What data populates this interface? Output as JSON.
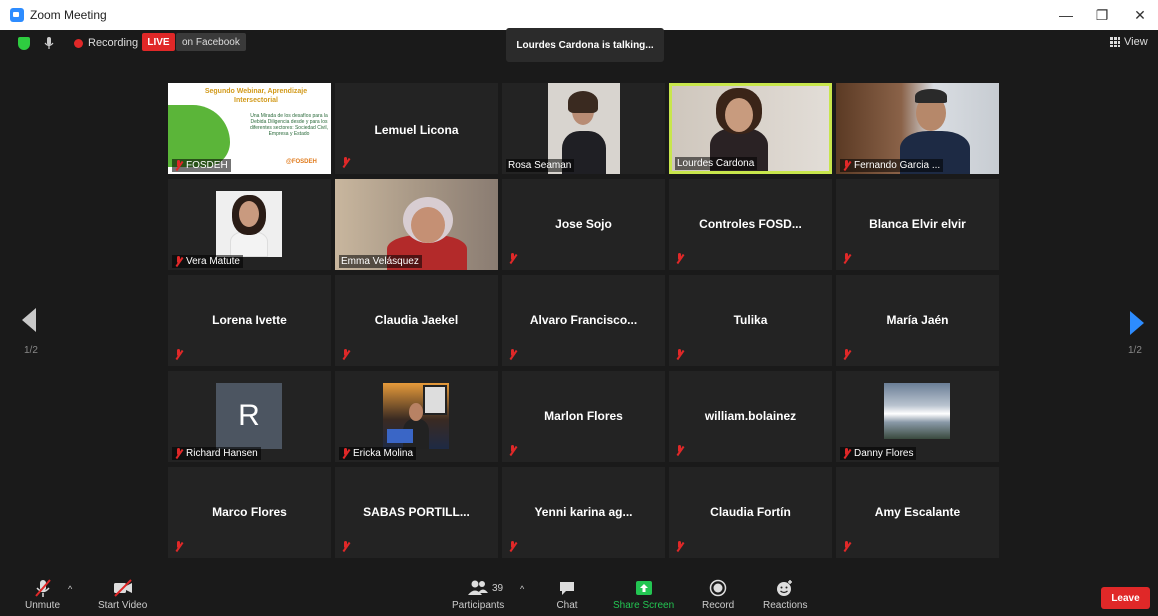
{
  "window": {
    "title": "Zoom Meeting",
    "minimize": "—",
    "restore": "❐",
    "close": "✕"
  },
  "topbar": {
    "recording_label": "Recording",
    "live_label": "LIVE",
    "on_facebook_label": "on Facebook",
    "talking_text": "Lourdes Cardona is talking...",
    "view_label": "View"
  },
  "pagination": {
    "left_page": "1/2",
    "right_page": "1/2"
  },
  "slide": {
    "title": "Segundo Webinar, Aprendizaje Intersectorial",
    "body": "Una Mirada de los desafíos para la Debida Diligencia desde y para los diferentes sectores: Sociedad Civil, Empresa y Estado",
    "logo": "@FOSDEH",
    "accent_color": "#5bb539"
  },
  "participants": [
    {
      "name": "FOSDEH",
      "kind": "slide",
      "muted": true
    },
    {
      "name": "Lemuel Licona",
      "kind": "name",
      "muted": true
    },
    {
      "name": "Rosa Seaman",
      "kind": "video",
      "muted": false
    },
    {
      "name": "Lourdes Cardona",
      "kind": "video",
      "muted": false,
      "active": true
    },
    {
      "name": "Fernando Garcia ...",
      "kind": "video",
      "muted": true
    },
    {
      "name": "Vera Matute",
      "kind": "photo",
      "muted": true
    },
    {
      "name": "Emma Velásquez",
      "kind": "video",
      "muted": false
    },
    {
      "name": "Jose Sojo",
      "kind": "name",
      "muted": true
    },
    {
      "name": "Controles  FOSD...",
      "kind": "name",
      "muted": true
    },
    {
      "name": "Blanca Elvir elvir",
      "kind": "name",
      "muted": true
    },
    {
      "name": "Lorena Ivette",
      "kind": "name",
      "muted": true
    },
    {
      "name": "Claudia Jaekel",
      "kind": "name",
      "muted": true
    },
    {
      "name": "Alvaro  Francisco...",
      "kind": "name",
      "muted": true
    },
    {
      "name": "Tulika",
      "kind": "name",
      "muted": true
    },
    {
      "name": "María Jaén",
      "kind": "name",
      "muted": true
    },
    {
      "name": "Richard Hansen",
      "kind": "avatar",
      "avatar_letter": "R",
      "muted": true
    },
    {
      "name": "Ericka Molina",
      "kind": "photo",
      "muted": true
    },
    {
      "name": "Marlon Flores",
      "kind": "name",
      "muted": true
    },
    {
      "name": "william.bolainez",
      "kind": "name",
      "muted": true
    },
    {
      "name": "Danny Flores",
      "kind": "photo",
      "muted": true
    },
    {
      "name": "Marco Flores",
      "kind": "name",
      "muted": true
    },
    {
      "name": "SABAS PORTILL...",
      "kind": "name",
      "muted": true
    },
    {
      "name": "Yenni  karina ag...",
      "kind": "name",
      "muted": true
    },
    {
      "name": "Claudia Fortín",
      "kind": "name",
      "muted": true
    },
    {
      "name": "Amy Escalante",
      "kind": "name",
      "muted": true
    }
  ],
  "toolbar": {
    "unmute": "Unmute",
    "start_video": "Start Video",
    "participants": "Participants",
    "participant_count": "39",
    "chat": "Chat",
    "share_screen": "Share Screen",
    "record": "Record",
    "reactions": "Reactions",
    "leave": "Leave"
  },
  "colors": {
    "active_speaker": "#c8e64c",
    "live_red": "#e02828",
    "share_green": "#23c552",
    "arrow_blue": "#2d8cff"
  }
}
